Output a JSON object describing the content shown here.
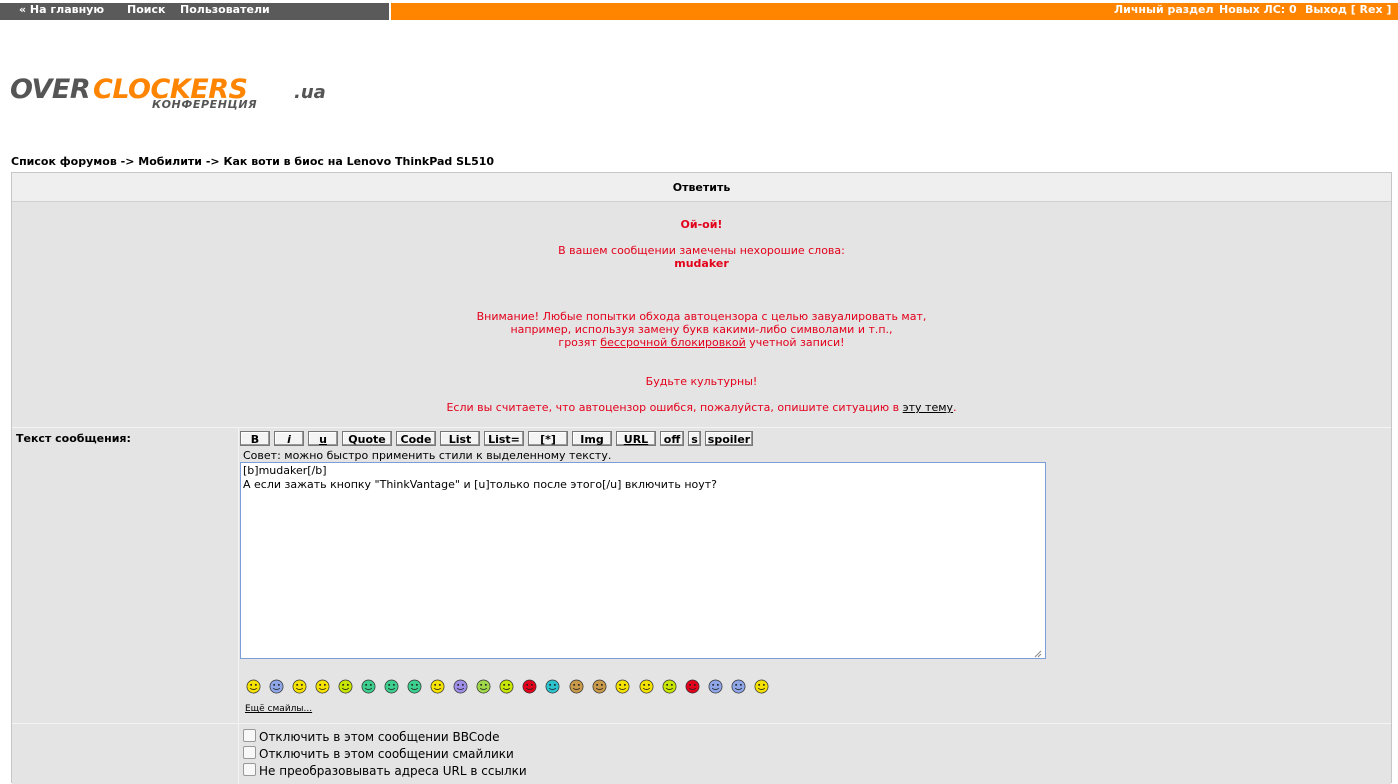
{
  "topbar": {
    "home": "« На главную",
    "search": "Поиск",
    "users": "Пользователи",
    "personal": "Личный раздел",
    "new_pm": "Новых ЛС: 0",
    "logout": "Выход [ Rex ]"
  },
  "logo": {
    "part1": "OVER",
    "part2": "CLOCKERS",
    "suffix": ".ua",
    "subtitle": "КОНФЕРЕНЦИЯ"
  },
  "breadcrumb": {
    "forums": "Список форумов",
    "sep": "->",
    "section": "Мобилити",
    "topic": "Как воти в биос на Lenovo ThinkPad SL510"
  },
  "form": {
    "title": "Ответить",
    "warning": {
      "title": "Ой-ой!",
      "detected": "В вашем сообщении замечены нехорошие слова:",
      "word": "mudaker",
      "attention_l1": "Внимание! Любые попытки обхода автоцензора с целью завуалировать мат,",
      "attention_l2": "например, используя замену букв какими-либо символами и т.п.,",
      "attention_l3_pre": "грозят",
      "attention_l3_link": "бессрочной блокировкой",
      "attention_l3_post": "учетной записи!",
      "polite": "Будьте культурны!",
      "mistake_pre": "Если вы считаете, что автоцензор ошибся, пожалуйста, опишите ситуацию в",
      "mistake_link": "эту тему",
      "mistake_post": "."
    },
    "message_label": "Текст сообщения:",
    "bbcode": [
      "B",
      "i",
      "u",
      "Quote",
      "Code",
      "List",
      "List=",
      "[*]",
      "Img",
      "URL",
      "off",
      "s",
      "spoiler"
    ],
    "hint": "Совет: можно быстро применить стили к выделенному тексту.",
    "message_text": "[b]mudaker[/b]\nА если зажать кнопку \"ThinkVantage\" и [u]только после этого[/u] включить ноут?",
    "more_smilies": "Ещё смайлы...",
    "options": [
      "Отключить в этом сообщении BBCode",
      "Отключить в этом сообщении смайлики",
      "Не преобразовывать адреса URL в ссылки"
    ]
  },
  "smilies": [
    {
      "icon": "smile-icon",
      "color": "#f5e200"
    },
    {
      "icon": "sad-icon",
      "color": "#8fa6e8"
    },
    {
      "icon": "happy-icon",
      "color": "#f5e200"
    },
    {
      "icon": "wink-icon",
      "color": "#f5e200"
    },
    {
      "icon": "neutral-icon",
      "color": "#c8e600"
    },
    {
      "icon": "grin-icon",
      "color": "#3ccf8e"
    },
    {
      "icon": "surprised-icon",
      "color": "#3ccf8e"
    },
    {
      "icon": "tongue-icon",
      "color": "#3ccf8e"
    },
    {
      "icon": "cool-icon",
      "color": "#f5e200"
    },
    {
      "icon": "confused-icon",
      "color": "#9f8fe8"
    },
    {
      "icon": "sick-icon",
      "color": "#9fd84a"
    },
    {
      "icon": "dead-icon",
      "color": "#c8e600"
    },
    {
      "icon": "angry-icon",
      "color": "#e3001b"
    },
    {
      "icon": "cry-icon",
      "color": "#2cc3cf"
    },
    {
      "icon": "thumbs-up-icon",
      "color": "#c99a4a"
    },
    {
      "icon": "thumbs-down-icon",
      "color": "#c99a4a"
    },
    {
      "icon": "smirk-icon",
      "color": "#f5e200"
    },
    {
      "icon": "rock-icon",
      "color": "#f5e200"
    },
    {
      "icon": "alien-icon",
      "color": "#c8e600"
    },
    {
      "icon": "devil-icon",
      "color": "#e3001b"
    },
    {
      "icon": "shy-icon",
      "color": "#8fa6e8"
    },
    {
      "icon": "idea-icon",
      "color": "#8fa6e8"
    },
    {
      "icon": "beer-icon",
      "color": "#f5e200"
    }
  ]
}
